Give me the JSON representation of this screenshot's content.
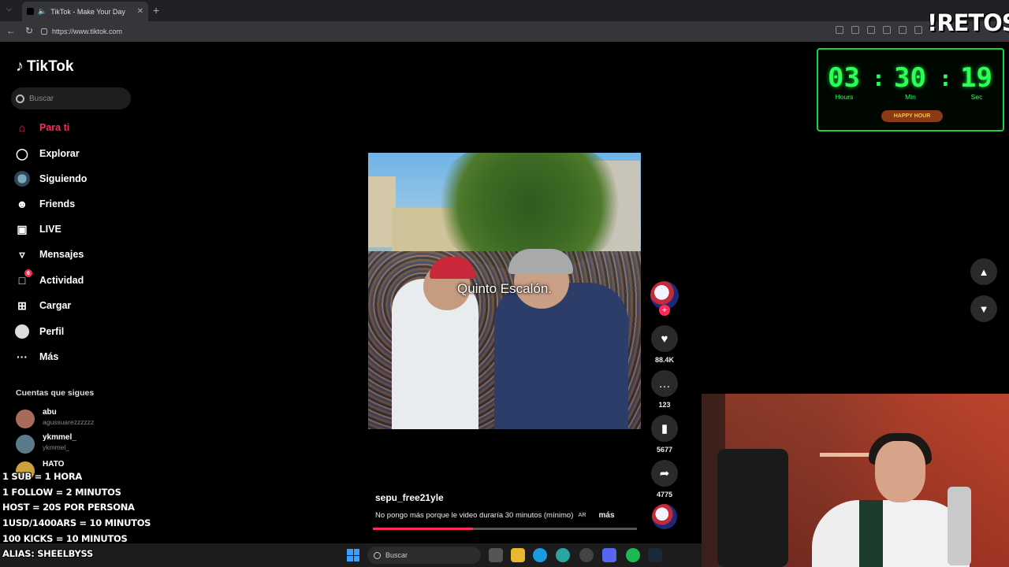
{
  "browser": {
    "tab_title": "TikTok - Make Your Day",
    "url": "https://www.tiktok.com"
  },
  "tiktok": {
    "logo_text": "TikTok",
    "search_placeholder": "Buscar",
    "nav": [
      {
        "label": "Para ti",
        "icon": "home-icon",
        "active": true
      },
      {
        "label": "Explorar",
        "icon": "compass-icon"
      },
      {
        "label": "Siguiendo",
        "icon": "following-avatar-icon"
      },
      {
        "label": "Friends",
        "icon": "friends-icon"
      },
      {
        "label": "LIVE",
        "icon": "live-tv-icon"
      },
      {
        "label": "Mensajes",
        "icon": "send-icon"
      },
      {
        "label": "Actividad",
        "icon": "activity-icon",
        "badge": "6"
      },
      {
        "label": "Cargar",
        "icon": "upload-plus-icon"
      },
      {
        "label": "Perfil",
        "icon": "profile-icon"
      },
      {
        "label": "Más",
        "icon": "more-dots-icon"
      }
    ],
    "following_title": "Cuentas que sigues",
    "following": [
      {
        "name": "abu",
        "handle": "agussuarezzzzzz"
      },
      {
        "name": "ykmmel_",
        "handle": "ykmmel_"
      },
      {
        "name": "HATO",
        "handle": ""
      }
    ]
  },
  "post": {
    "caption_overlay": "Quinto Escalón.",
    "author": "sepu_free21yle",
    "description": "No pongo más porque le video duraría 30 minutos (mínimo)",
    "region_tag": "AR",
    "more_label": "más",
    "likes": "88.4K",
    "comments": "123",
    "saves": "5677",
    "shares": "4775",
    "progress": 0.38
  },
  "stream": {
    "timer": {
      "hours": "03",
      "minutes": "30",
      "seconds": "19",
      "hours_label": "Hours",
      "min_label": "Min",
      "sec_label": "Sec",
      "button": "HAPPY HOUR"
    },
    "brand": "!RETOS",
    "rules": [
      "1 SUB = 1 HORA",
      "1 FOLLOW = 2 MINUTOS",
      "HOST = 20S POR PERSONA",
      "1USD/1400ARS = 10 MINUTOS",
      "100 KICKS = 10 MINUTOS",
      "ALIAS: SHEELBYSS"
    ]
  },
  "taskbar": {
    "search_placeholder": "Buscar"
  },
  "colors": {
    "accent": "#fe2c55",
    "timer_green": "#2aff56"
  }
}
